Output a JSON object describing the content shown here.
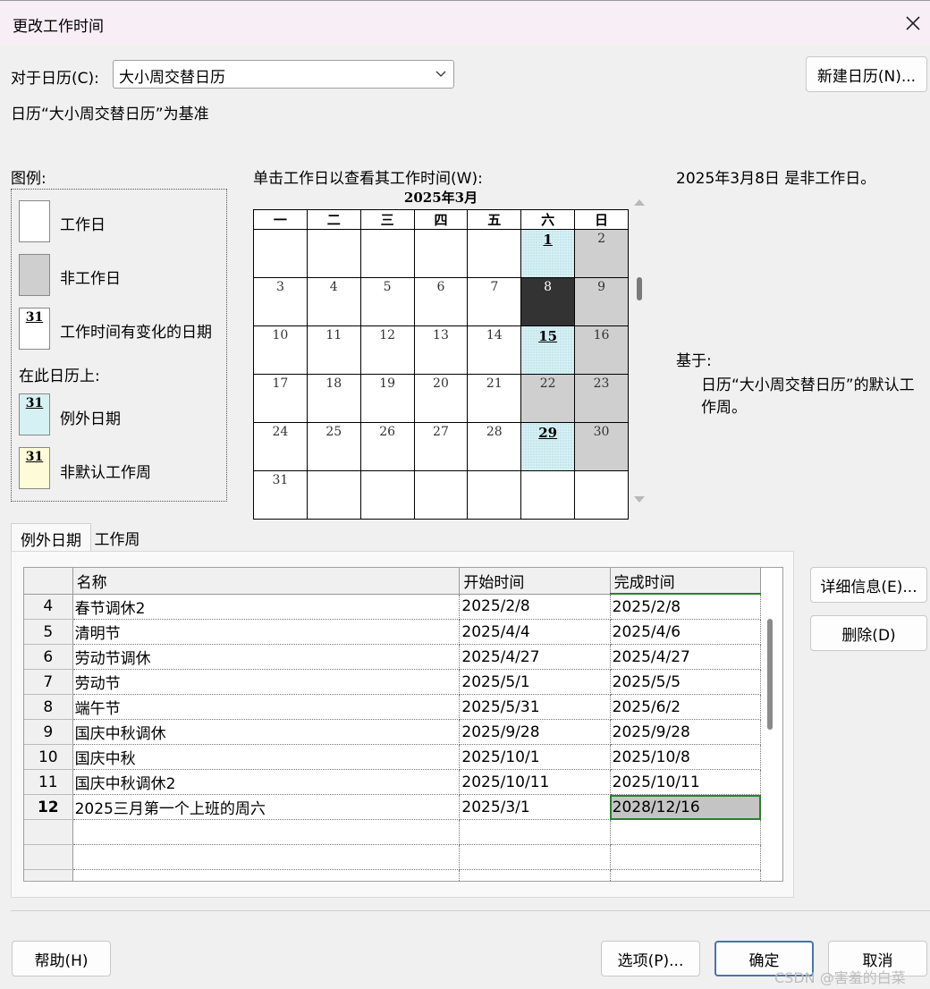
{
  "dialog": {
    "title": "更改工作时间",
    "calendar_label": "对于日历(C):",
    "calendar_value": "大小周交替日历",
    "new_calendar_button": "新建日历(N)...",
    "base_text": "日历“大小周交替日历”为基准"
  },
  "legend": {
    "title": "图例:",
    "working": "工作日",
    "nonworking": "非工作日",
    "changed": "工作时间有变化的日期",
    "on_calendar": "在此日历上:",
    "exception": "例外日期",
    "nondefault": "非默认工作周",
    "sample_num": "31"
  },
  "calendar": {
    "instruction": "单击工作日以查看其工作时间(W):",
    "month_title": "2025年3月",
    "weekdays": [
      "一",
      "二",
      "三",
      "四",
      "五",
      "六",
      "日"
    ],
    "weeks": [
      [
        {
          "d": "",
          "t": "empty"
        },
        {
          "d": "",
          "t": "empty"
        },
        {
          "d": "",
          "t": "empty"
        },
        {
          "d": "",
          "t": "empty"
        },
        {
          "d": "",
          "t": "empty"
        },
        {
          "d": "1",
          "t": "exc changed"
        },
        {
          "d": "2",
          "t": "nonwork"
        }
      ],
      [
        {
          "d": "3",
          "t": ""
        },
        {
          "d": "4",
          "t": ""
        },
        {
          "d": "5",
          "t": ""
        },
        {
          "d": "6",
          "t": ""
        },
        {
          "d": "7",
          "t": ""
        },
        {
          "d": "8",
          "t": "sel"
        },
        {
          "d": "9",
          "t": "nonwork"
        }
      ],
      [
        {
          "d": "10",
          "t": ""
        },
        {
          "d": "11",
          "t": ""
        },
        {
          "d": "12",
          "t": ""
        },
        {
          "d": "13",
          "t": ""
        },
        {
          "d": "14",
          "t": ""
        },
        {
          "d": "15",
          "t": "exc changed"
        },
        {
          "d": "16",
          "t": "nonwork"
        }
      ],
      [
        {
          "d": "17",
          "t": ""
        },
        {
          "d": "18",
          "t": ""
        },
        {
          "d": "19",
          "t": ""
        },
        {
          "d": "20",
          "t": ""
        },
        {
          "d": "21",
          "t": ""
        },
        {
          "d": "22",
          "t": "nonwork"
        },
        {
          "d": "23",
          "t": "nonwork"
        }
      ],
      [
        {
          "d": "24",
          "t": ""
        },
        {
          "d": "25",
          "t": ""
        },
        {
          "d": "26",
          "t": ""
        },
        {
          "d": "27",
          "t": ""
        },
        {
          "d": "28",
          "t": ""
        },
        {
          "d": "29",
          "t": "exc changed"
        },
        {
          "d": "30",
          "t": "nonwork"
        }
      ],
      [
        {
          "d": "31",
          "t": ""
        },
        {
          "d": "",
          "t": "empty"
        },
        {
          "d": "",
          "t": "empty"
        },
        {
          "d": "",
          "t": "empty"
        },
        {
          "d": "",
          "t": "empty"
        },
        {
          "d": "",
          "t": "empty"
        },
        {
          "d": "",
          "t": "empty"
        }
      ]
    ]
  },
  "info": {
    "selected_status": "2025年3月8日 是非工作日。",
    "based_on_label": "基于:",
    "based_on_text": "日历“大小周交替日历”的默认工作周。"
  },
  "tabs": {
    "exceptions": "例外日期",
    "work_weeks": "工作周"
  },
  "table": {
    "headers": [
      "名称",
      "开始时间",
      "完成时间"
    ],
    "rows": [
      {
        "n": "4",
        "name": "春节调休2",
        "start": "2025/2/8",
        "end": "2025/2/8"
      },
      {
        "n": "5",
        "name": "清明节",
        "start": "2025/4/4",
        "end": "2025/4/6"
      },
      {
        "n": "6",
        "name": "劳动节调休",
        "start": "2025/4/27",
        "end": "2025/4/27"
      },
      {
        "n": "7",
        "name": "劳动节",
        "start": "2025/5/1",
        "end": "2025/5/5"
      },
      {
        "n": "8",
        "name": "端午节",
        "start": "2025/5/31",
        "end": "2025/6/2"
      },
      {
        "n": "9",
        "name": "国庆中秋调休",
        "start": "2025/9/28",
        "end": "2025/9/28"
      },
      {
        "n": "10",
        "name": "国庆中秋",
        "start": "2025/10/1",
        "end": "2025/10/8"
      },
      {
        "n": "11",
        "name": "国庆中秋调休2",
        "start": "2025/10/11",
        "end": "2025/10/11"
      },
      {
        "n": "12",
        "name": "2025三月第一个上班的周六",
        "start": "2025/3/1",
        "end": "2028/12/16"
      }
    ]
  },
  "side_buttons": {
    "details": "详细信息(E)...",
    "delete": "删除(D)"
  },
  "footer": {
    "help": "帮助(H)",
    "options": "选项(P)...",
    "ok": "确定",
    "cancel": "取消"
  },
  "watermark": "CSDN @害羞的白菜",
  "colors": {
    "nonworking": "#cfcfcf",
    "exception": "#d6f1f4",
    "nondefault": "#fdfbd8",
    "selected": "#333333",
    "focus_outline": "#2e7d32"
  }
}
